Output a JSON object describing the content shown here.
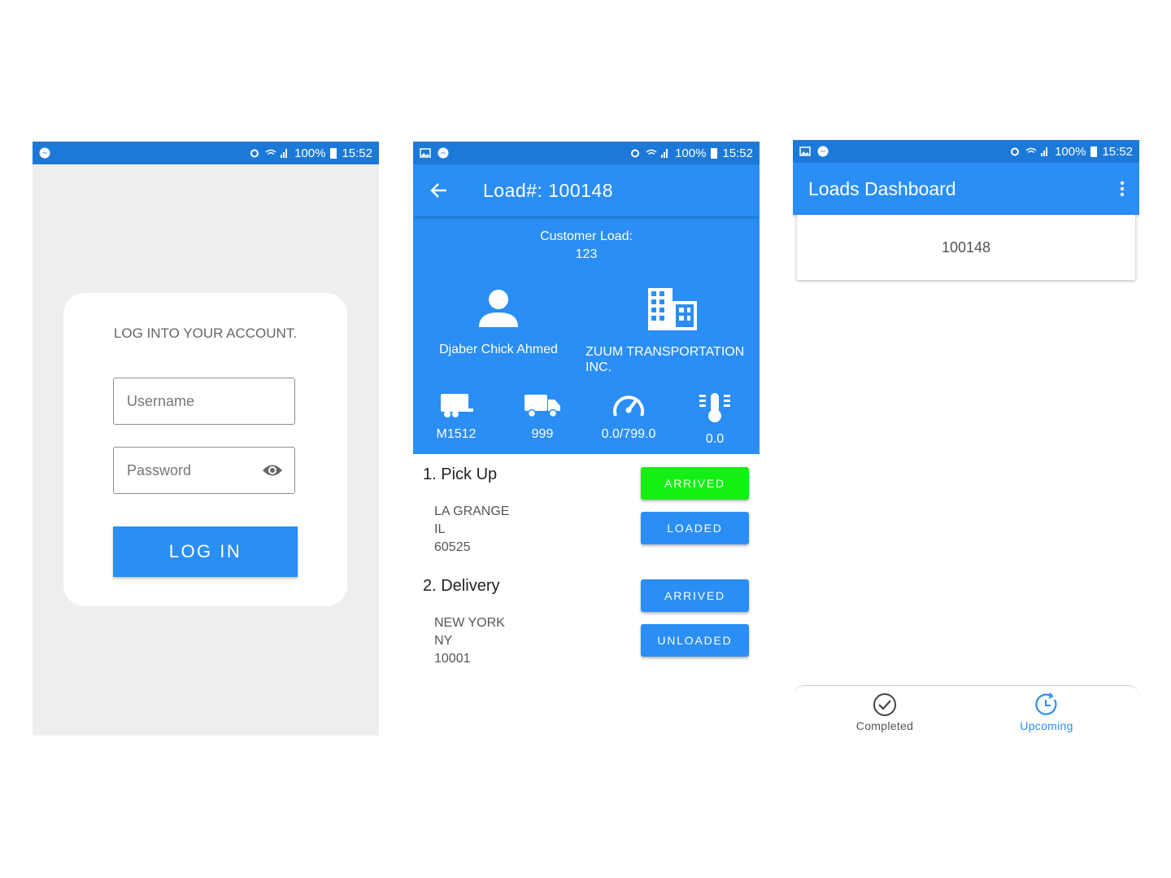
{
  "status": {
    "battery": "100%",
    "time": "15:52"
  },
  "login": {
    "title": "LOG INTO YOUR ACCOUNT.",
    "username_placeholder": "Username",
    "password_placeholder": "Password",
    "login_label": "LOG IN"
  },
  "load": {
    "title": "Load#: 100148",
    "customer_load_label": "Customer Load:",
    "customer_load_value": "123",
    "driver_name": "Djaber Chick Ahmed",
    "company_name": "ZUUM TRANSPORTATION INC.",
    "stats": [
      {
        "icon": "trailer-icon",
        "value": "M1512"
      },
      {
        "icon": "truck-icon",
        "value": "999"
      },
      {
        "icon": "speedometer-icon",
        "value": "0.0/799.0"
      },
      {
        "icon": "thermometer-icon",
        "value": "0.0"
      }
    ],
    "stops": [
      {
        "title": "1. Pick Up",
        "city": "LA GRANGE",
        "state": "IL",
        "zip": "60525",
        "btn1": "ARRIVED",
        "btn2": "LOADED",
        "btn1_color": "#14f014"
      },
      {
        "title": "2. Delivery",
        "city": "NEW YORK",
        "state": "NY",
        "zip": "10001",
        "btn1": "ARRIVED",
        "btn2": "UNLOADED",
        "btn1_color": "#2a8ef5"
      }
    ]
  },
  "dashboard": {
    "title": "Loads Dashboard",
    "load_item": "100148",
    "nav": [
      {
        "label": "Completed",
        "icon": "check-circle-icon",
        "active": false
      },
      {
        "label": "Upcoming",
        "icon": "upcoming-clock-icon",
        "active": true
      }
    ]
  },
  "colors": {
    "primary": "#2a8ef5",
    "statusbar": "#1d79d8",
    "arrived_green": "#14f014"
  }
}
